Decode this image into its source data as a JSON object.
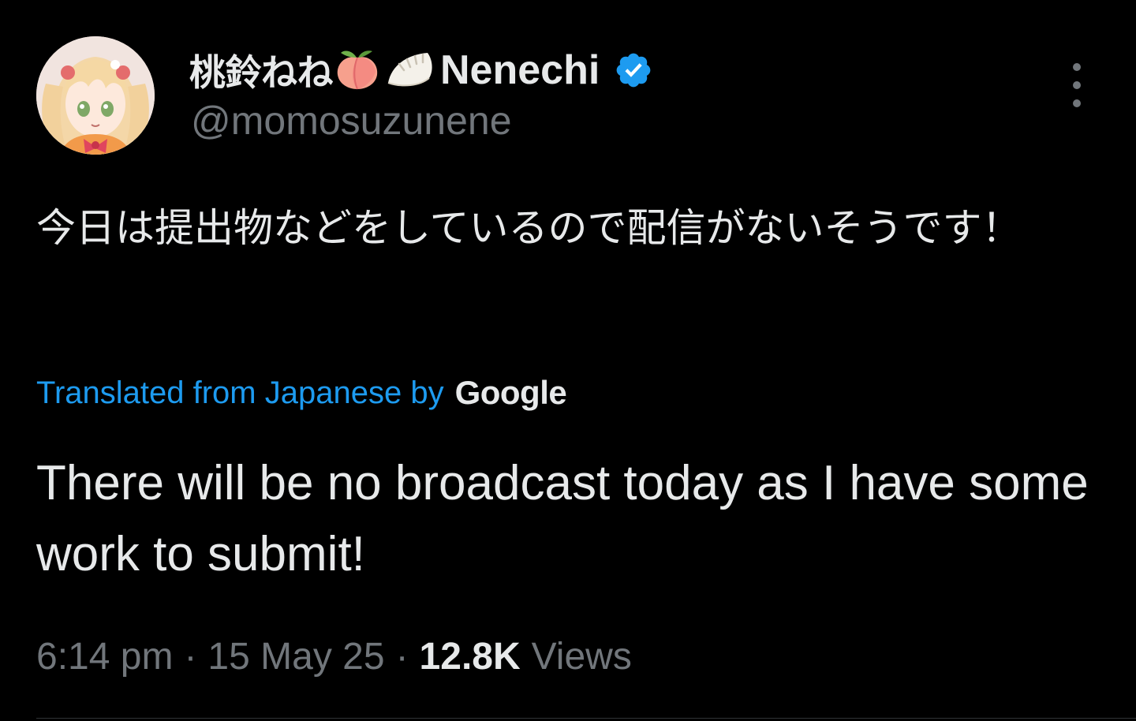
{
  "author": {
    "display_name": "桃鈴ねね",
    "display_name_suffix": "Nenechi",
    "handle": "@momosuzunene",
    "verified": true,
    "verified_color": "#1d9bf0",
    "emojis": [
      "peach-emoji",
      "dumpling-emoji"
    ]
  },
  "tweet": {
    "original_text": "今日は提出物などをしているので配信がないそうです！",
    "translation_label": "Translated from Japanese by",
    "translation_provider": "Google",
    "translated_text": "There will be no broadcast today as I have some work to submit!",
    "time": "6:14 pm",
    "date": "15 May 25",
    "views_count": "12.8K",
    "views_label": "Views"
  },
  "colors": {
    "background": "#000000",
    "primary_text": "#e7e9ea",
    "secondary_text": "#71767b",
    "link": "#1d9bf0"
  },
  "more_menu_icon": "more-vertical-icon"
}
